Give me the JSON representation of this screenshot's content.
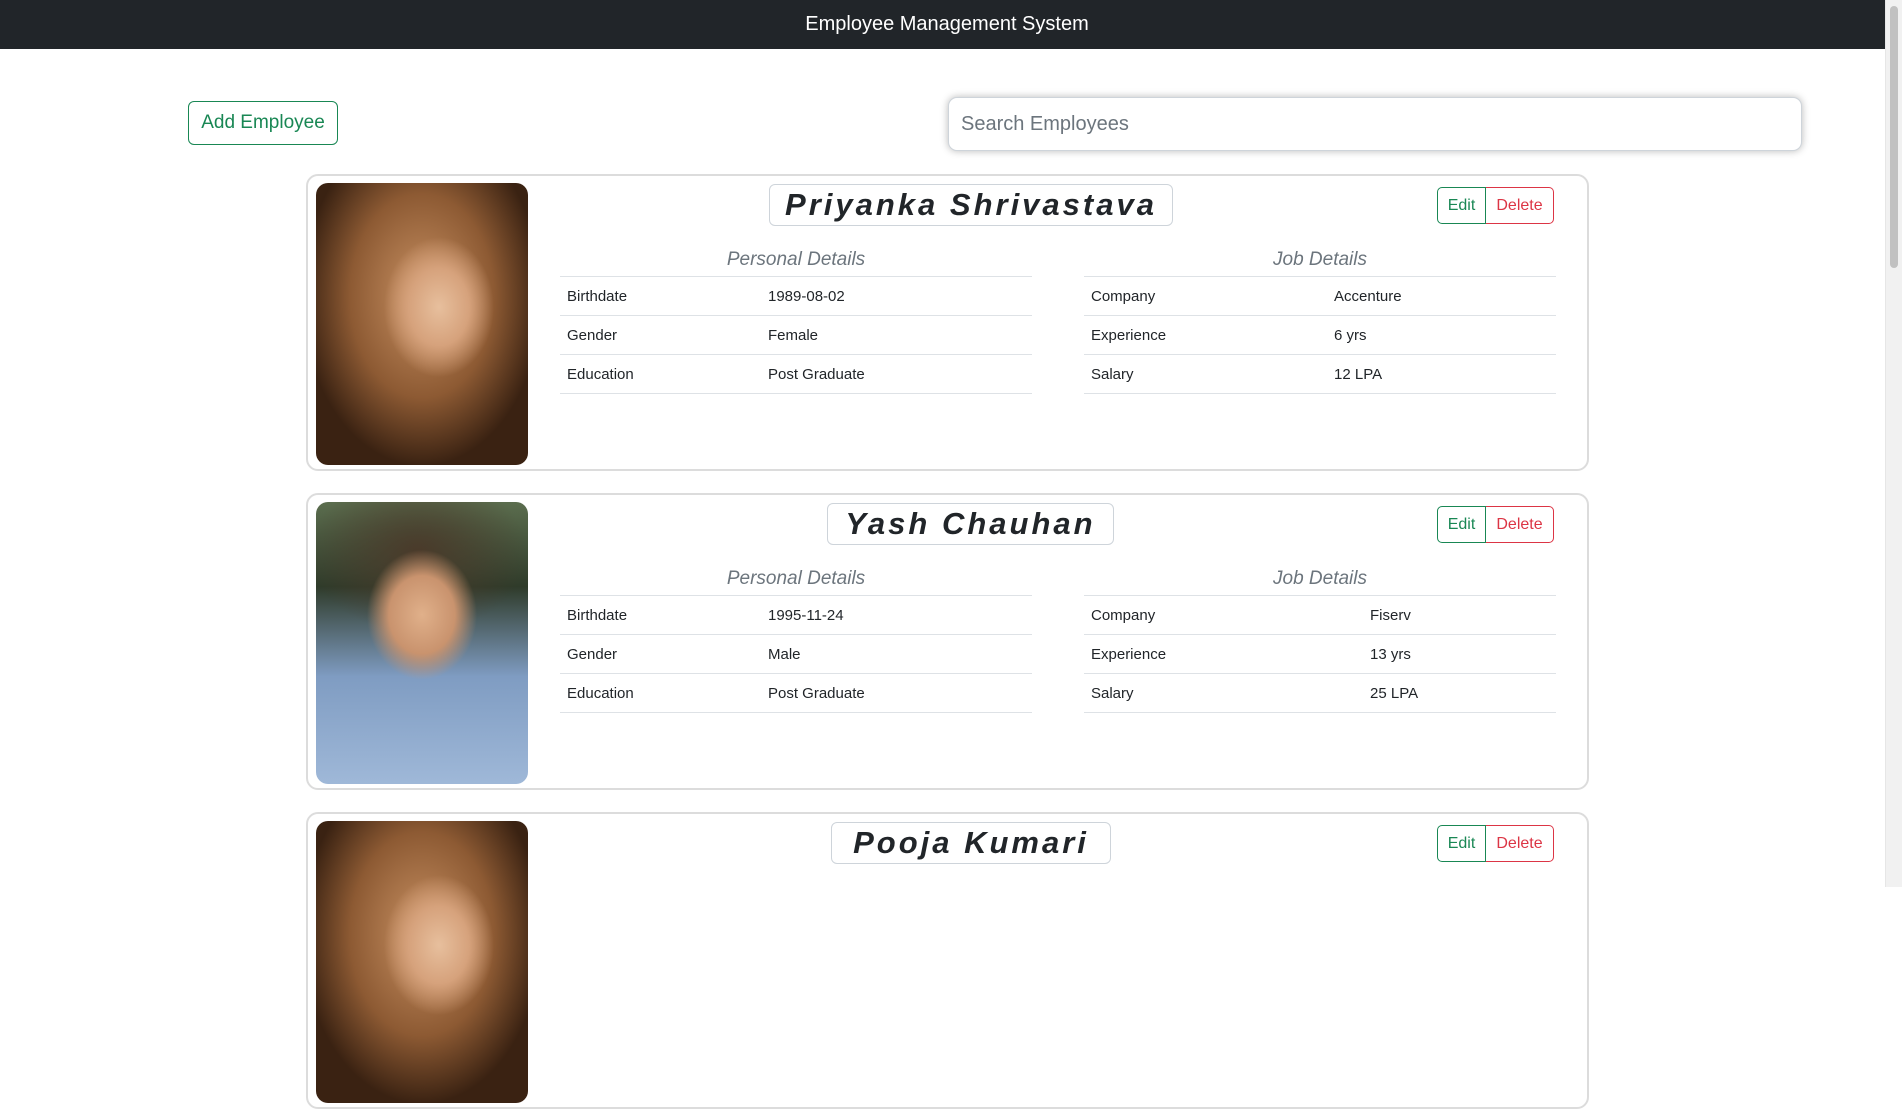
{
  "app": {
    "title": "Employee Management System"
  },
  "toolbar": {
    "add_label": "Add Employee",
    "search_placeholder": "Search Employees",
    "search_value": ""
  },
  "colors": {
    "navbar": "#212529",
    "success": "#198754",
    "danger": "#dc3545",
    "muted": "#6c757d"
  },
  "employees": [
    {
      "name": "Priyanka Shrivastava",
      "photo": "woman-portrait",
      "edit_label": "Edit",
      "delete_label": "Delete",
      "personal": {
        "title": "Personal Details",
        "rows": [
          {
            "label": "Birthdate",
            "value": "1989-08-02"
          },
          {
            "label": "Gender",
            "value": "Female"
          },
          {
            "label": "Education",
            "value": "Post Graduate"
          }
        ]
      },
      "job": {
        "title": "Job Details",
        "rows": [
          {
            "label": "Company",
            "value": "Accenture"
          },
          {
            "label": "Experience",
            "value": "6 yrs"
          },
          {
            "label": "Salary",
            "value": "12 LPA"
          }
        ]
      }
    },
    {
      "name": "Yash Chauhan",
      "photo": "man-portrait",
      "edit_label": "Edit",
      "delete_label": "Delete",
      "personal": {
        "title": "Personal Details",
        "rows": [
          {
            "label": "Birthdate",
            "value": "1995-11-24"
          },
          {
            "label": "Gender",
            "value": "Male"
          },
          {
            "label": "Education",
            "value": "Post Graduate"
          }
        ]
      },
      "job": {
        "title": "Job Details",
        "rows": [
          {
            "label": "Company",
            "value": "Fiserv"
          },
          {
            "label": "Experience",
            "value": "13 yrs"
          },
          {
            "label": "Salary",
            "value": "25 LPA"
          }
        ]
      }
    },
    {
      "name": "Pooja Kumari",
      "photo": "woman-portrait",
      "edit_label": "Edit",
      "delete_label": "Delete"
    }
  ]
}
